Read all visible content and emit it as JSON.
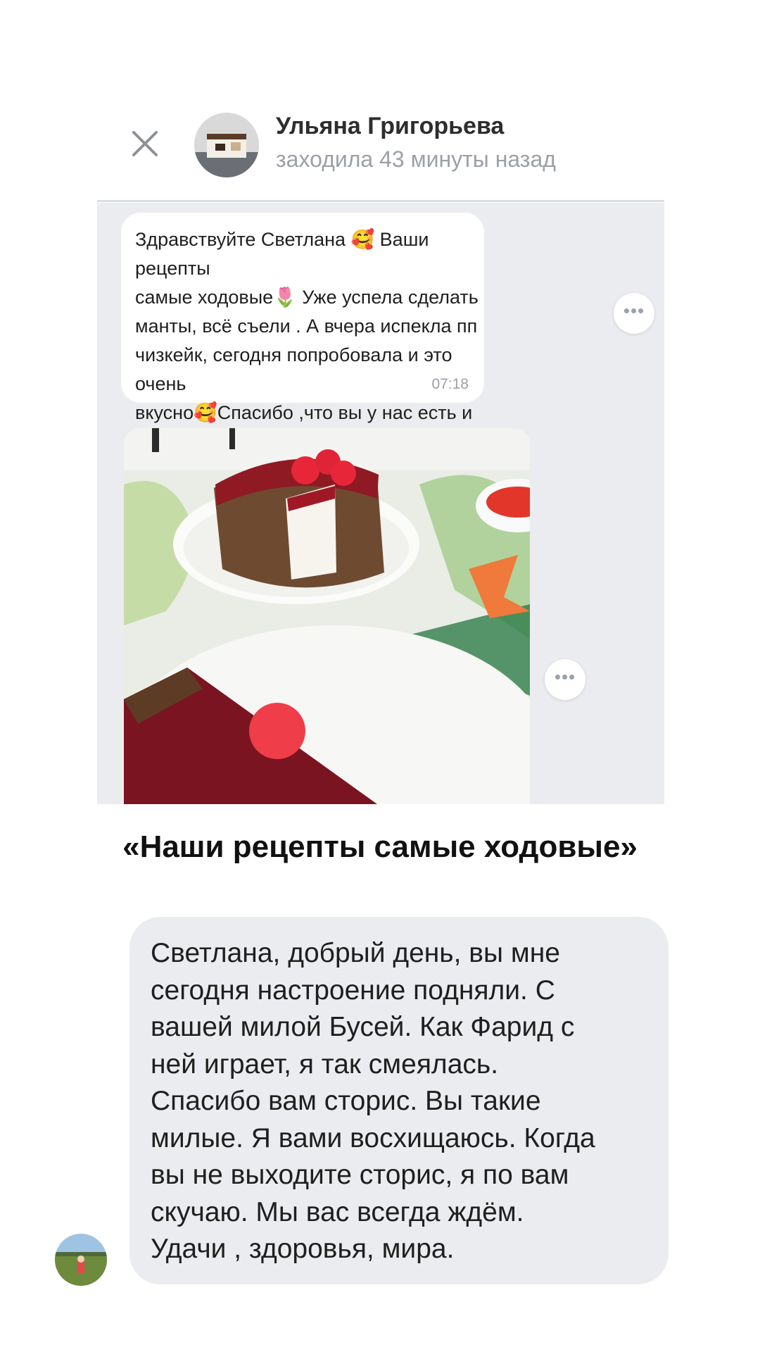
{
  "header": {
    "name": "Ульяна Григорьева",
    "status": "заходила 43 минуты назад",
    "close_icon": "close-icon"
  },
  "messages": [
    {
      "text": "Здравствуйте Светлана 🥰 Ваши рецепты\nсамые ходовые🌷 Уже успела сделать\nманты, всё съели . А  вчера испекла пп\nчизкейк, сегодня попробовала и это очень\nвкусно🥰Спасибо ,что вы у нас есть и\nучите чему-то новому😳",
      "time": "07:18",
      "more_label": "•••"
    },
    {
      "photo": "cheesecake-photo",
      "more_label": "•••"
    }
  ],
  "caption": "«Наши рецепты самые ходовые»",
  "second_message": {
    "text": "Светлана, добрый день, вы мне\nсегодня настроение подняли. С\nвашей милой Бусей. Как Фарид с\nней играет, я так смеялась.\nСпасибо вам сторис. Вы такие\nмилые. Я вами восхищаюсь. Когда\nвы не выходите сторис, я по вам\nскучаю. Мы  вас всегда ждём.\nУдачи , здоровья, мира."
  },
  "colors": {
    "chat_background": "#ebecef",
    "bubble": "#ffffff",
    "status_text": "#9ca0a6"
  }
}
